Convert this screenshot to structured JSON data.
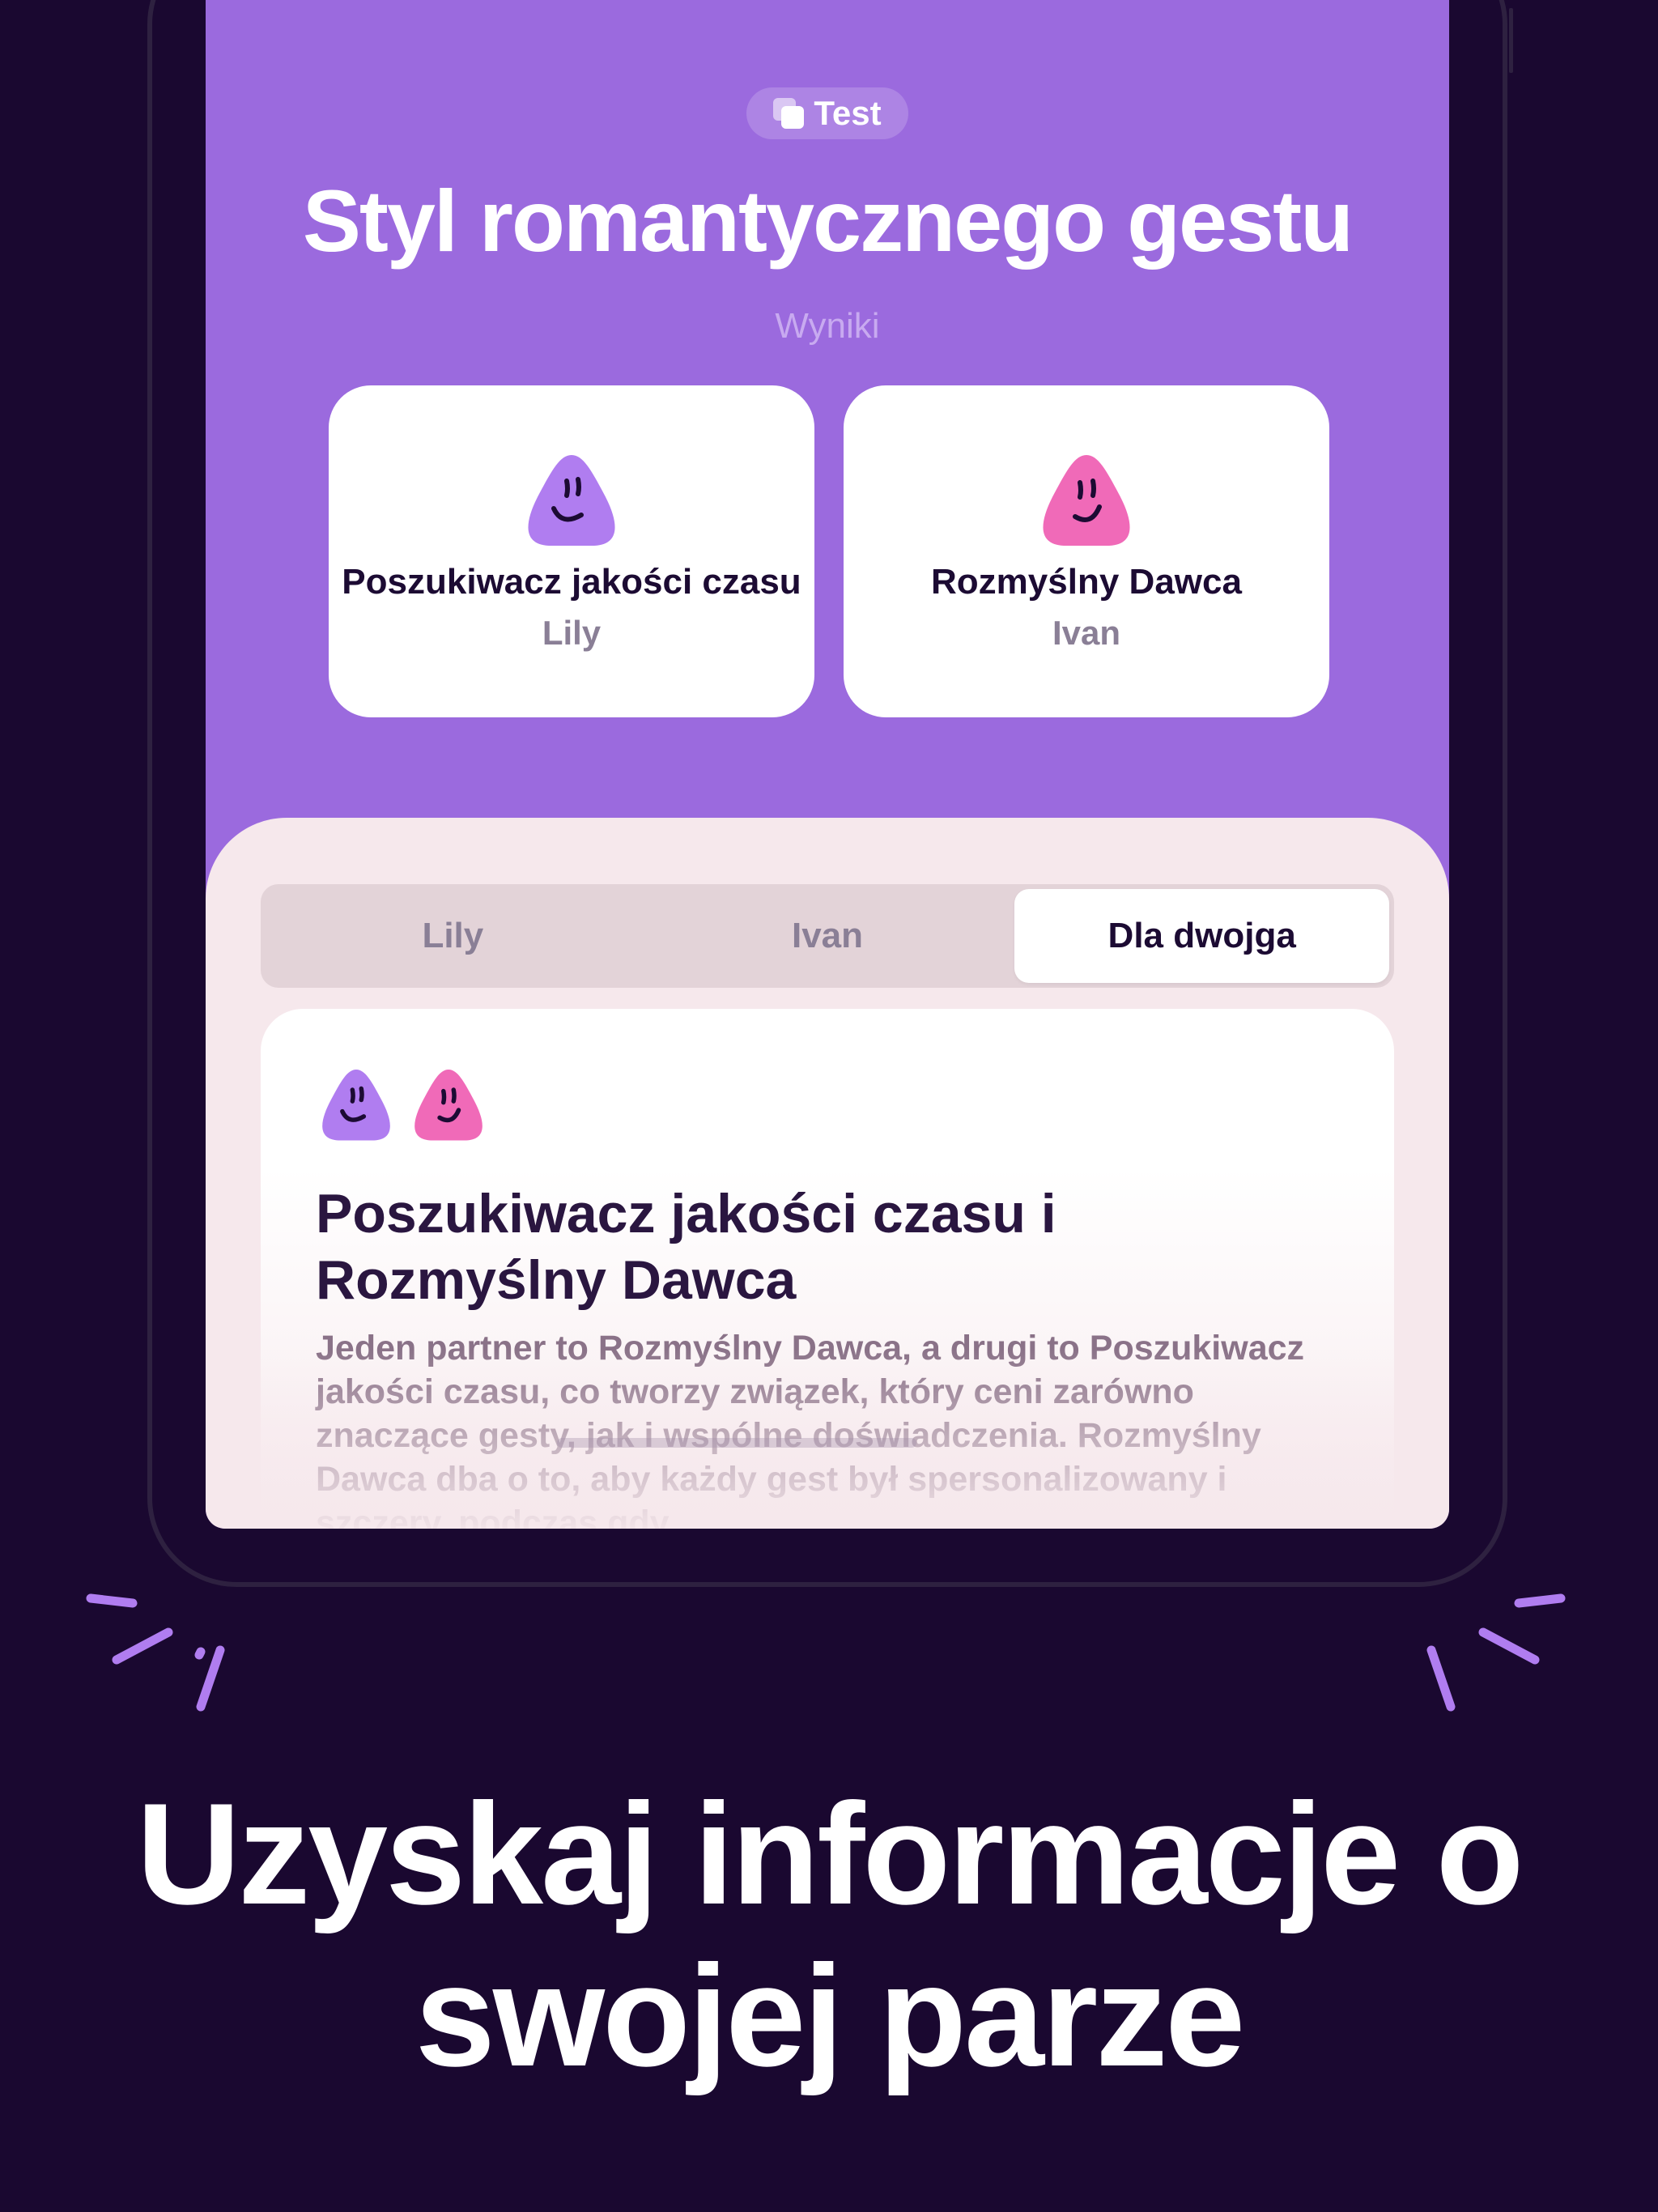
{
  "header": {
    "badge_label": "Test",
    "title": "Styl romantycznego gestu",
    "subtitle": "Wyniki"
  },
  "results": [
    {
      "type_name": "Poszukiwacz jakości czasu",
      "person": "Lily",
      "face_color": "#b07df0",
      "face_icon": "purple-smiley-icon"
    },
    {
      "type_name": "Rozmyślny Dawca",
      "person": "Ivan",
      "face_color": "#f06ab8",
      "face_icon": "pink-smiley-icon"
    }
  ],
  "tabs": {
    "items": [
      "Lily",
      "Ivan",
      "Dla dwojga"
    ],
    "active": "Dla dwojga"
  },
  "couple_card": {
    "title": "Poszukiwacz jakości czasu i Rozmyślny Dawca",
    "text": "Jeden partner to Rozmyślny Dawca, a drugi to Poszukiwacz jakości czasu, co tworzy związek, który ceni zarówno znaczące gesty, jak i wspólne doświadczenia. Rozmyślny Dawca dba o to, aby każdy gest był spersonalizowany i szczery, podczas gdy"
  },
  "headline": "Uzyskaj informacje o swojej parze",
  "colors": {
    "background": "#1a0830",
    "screen_accent": "#9b6ade",
    "sheet": "#f6e8ec",
    "sparkle": "#b07df0"
  }
}
